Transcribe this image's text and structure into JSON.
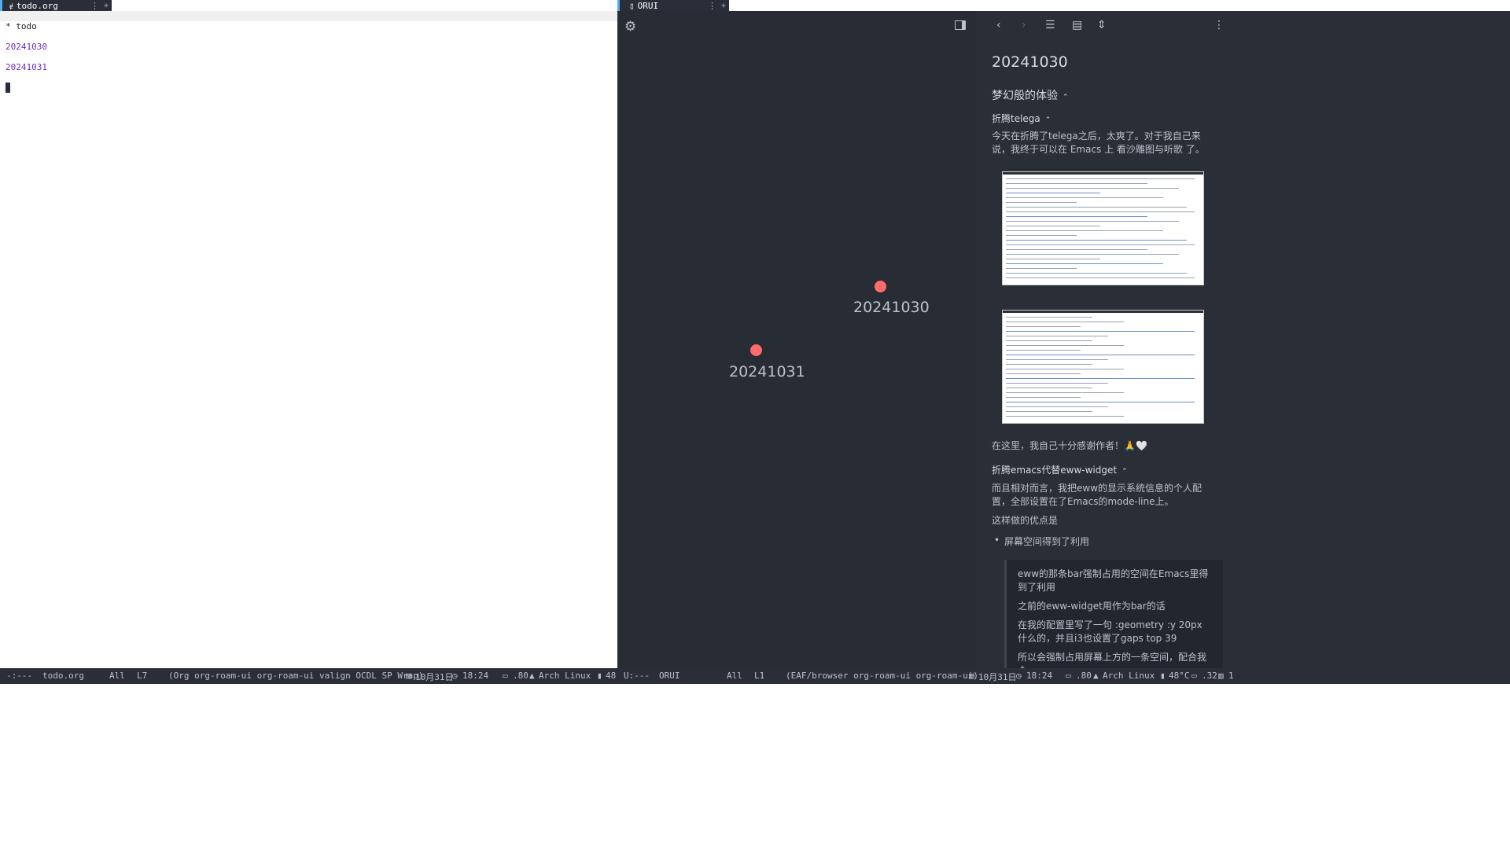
{
  "left": {
    "tab": {
      "icon": "emacs-icon",
      "label": "todo.org",
      "separator": "⋮",
      "add": "+"
    },
    "lines": {
      "heading": "* todo",
      "link1": "20241030",
      "link2": "20241031"
    },
    "modeline": {
      "state": "-:---",
      "buffer": "todo.org",
      "position": "All",
      "line": "L7",
      "modes": "(Org org-roam-ui org-roam-ui valign OCDL SP Wrap)",
      "date": "10月31日",
      "time": "18:24",
      "load": ".80",
      "os": "Arch Linux",
      "battery": "48"
    }
  },
  "right": {
    "tab": {
      "icon": "file-icon",
      "label": "ORUI",
      "separator": "⋮",
      "add": "+"
    },
    "graph": {
      "nodes": [
        {
          "label": "20241030"
        },
        {
          "label": "20241031"
        }
      ],
      "node_color": "#ff6c6b"
    },
    "sidebar": {
      "title": "20241030",
      "h_dream": "梦幻般的体验",
      "h_telega": "折腾telega",
      "p_telega": "今天在折腾了telega之后，太爽了。对于我自己来说，我终于可以在 Emacs 上 看沙雕图与听歌 了。",
      "p_thanks": "在这里，我自己十分感谢作者！🙏🤍",
      "h_eww": "折腾emacs代替eww-widget",
      "p_eww": "而且相对而言，我把eww的显示系统信息的个人配置，全部设置在了Emacs的mode-line上。",
      "p_advantages": "这样做的优点是",
      "li_space": "屏幕空间得到了利用",
      "quote": [
        "eww的那条bar强制占用的空间在Emacs里得到了利用",
        "之前的eww-widget用作为bar的话",
        "在我的配置里写了一句 :geometry :y 20px 什么的，并且i3也设置了gaps top 39",
        "所以会强制占用屏幕上方的一条空间，配合我个"
      ]
    },
    "modeline": {
      "state": "U:---",
      "buffer": "ORUI",
      "position": "All",
      "line": "L1",
      "modes": "(EAF/browser org-roam-ui org-roam-ui)",
      "date": "10月31日",
      "time": "18:24",
      "load": ".80",
      "os": "Arch Linux",
      "temp": "48°C",
      "mem": ".32",
      "extra": "1"
    }
  },
  "colors": {
    "accent": "#51afef",
    "link": "#6c2fb4",
    "node": "#ff6c6b",
    "bg_dark": "#282c34"
  }
}
